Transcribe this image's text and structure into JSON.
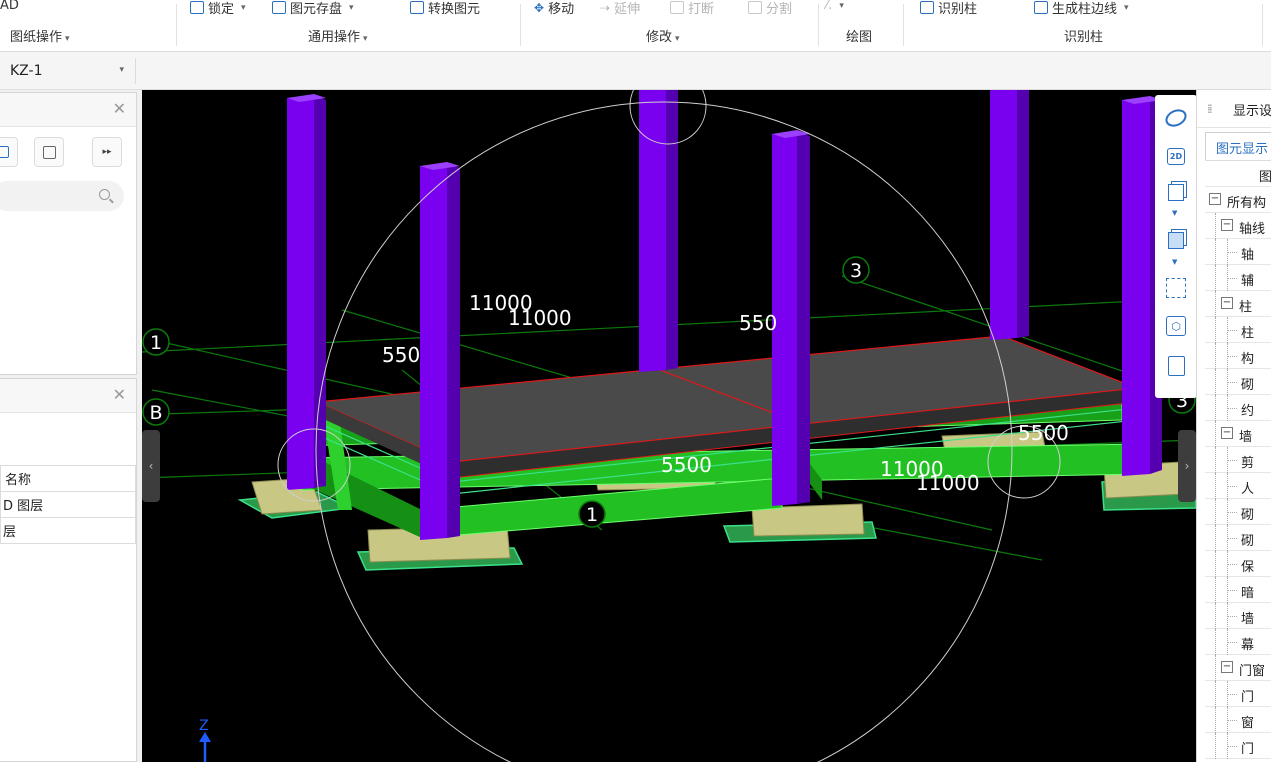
{
  "ribbon": {
    "app_fragment": "AD",
    "groups": [
      {
        "label": "图纸操作"
      },
      {
        "label": "通用操作"
      },
      {
        "label": "修改"
      },
      {
        "label": "绘图"
      },
      {
        "label": "识别柱"
      }
    ],
    "top_items": {
      "lock": "锁定",
      "save_element": "图元存盘",
      "convert_element": "转换图元",
      "move": "移动",
      "extend": "延伸",
      "break": "打断",
      "split": "分割",
      "identify_column": "识别柱",
      "generate_edge": "生成柱边线"
    }
  },
  "selector": {
    "value": "KZ-1"
  },
  "left_panel_1": {},
  "left_panel_2": {
    "header_name": "名称",
    "rows": [
      "D 图层",
      "层"
    ]
  },
  "viewport": {
    "axis_labels": [
      "1",
      "B",
      "3",
      "1",
      "3"
    ],
    "dimensions": [
      "11000",
      "11000",
      "550",
      "550",
      "5500",
      "5500",
      "11000",
      "11000"
    ],
    "gizmo_axis": "Z"
  },
  "vtoolbar": {
    "btn_2d": "2D"
  },
  "right_panel": {
    "title": "显示设",
    "tab": "图元显示",
    "column_header": "图",
    "tree": [
      {
        "label": "所有构",
        "level": 0,
        "box": "−"
      },
      {
        "label": "轴线",
        "level": 1,
        "box": "−"
      },
      {
        "label": "轴",
        "level": 2
      },
      {
        "label": "辅",
        "level": 2
      },
      {
        "label": "柱",
        "level": 1,
        "box": "−"
      },
      {
        "label": "柱",
        "level": 2
      },
      {
        "label": "构",
        "level": 2
      },
      {
        "label": "砌",
        "level": 2
      },
      {
        "label": "约",
        "level": 2
      },
      {
        "label": "墙",
        "level": 1,
        "box": "−"
      },
      {
        "label": "剪",
        "level": 2
      },
      {
        "label": "人",
        "level": 2
      },
      {
        "label": "砌",
        "level": 2
      },
      {
        "label": "砌",
        "level": 2
      },
      {
        "label": "保",
        "level": 2
      },
      {
        "label": "暗",
        "level": 2
      },
      {
        "label": "墙",
        "level": 2
      },
      {
        "label": "幕",
        "level": 2
      },
      {
        "label": "门窗",
        "level": 1,
        "box": "−"
      },
      {
        "label": "门",
        "level": 2
      },
      {
        "label": "窗",
        "level": 2
      },
      {
        "label": "门",
        "level": 2
      }
    ]
  },
  "colors": {
    "column": "#7a00f0",
    "beam": "#22c022",
    "slab": "#4a4a4a",
    "footing": "#c8c884",
    "axis_line": "#0b7a0b",
    "accent": "#2b6fc0"
  }
}
